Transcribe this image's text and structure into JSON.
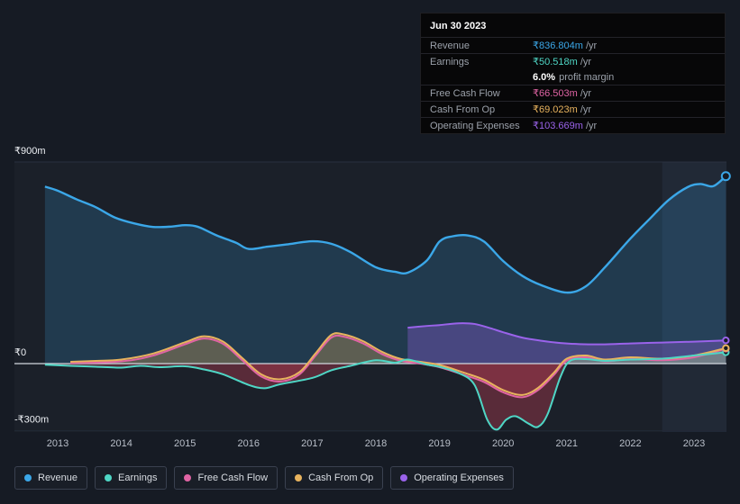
{
  "page": {
    "bg": "#161b24"
  },
  "tooltip": {
    "date": "Jun 30 2023",
    "rows": [
      {
        "label": "Revenue",
        "value": "₹836.804m",
        "suffix": "/yr",
        "color": "#3ba7e8"
      },
      {
        "label": "Earnings",
        "value": "₹50.518m",
        "suffix": "/yr",
        "color": "#4fd6c5"
      },
      {
        "label": "Free Cash Flow",
        "value": "₹66.503m",
        "suffix": "/yr",
        "color": "#e064a4"
      },
      {
        "label": "Cash From Op",
        "value": "₹69.023m",
        "suffix": "/yr",
        "color": "#e8b35e"
      },
      {
        "label": "Operating Expenses",
        "value": "₹103.669m",
        "suffix": "/yr",
        "color": "#9a63ea"
      }
    ],
    "profit_margin": {
      "value": "6.0%",
      "label": "profit margin"
    }
  },
  "legend": {
    "items": [
      {
        "label": "Revenue",
        "color": "#3ba7e8"
      },
      {
        "label": "Earnings",
        "color": "#4fd6c5"
      },
      {
        "label": "Free Cash Flow",
        "color": "#e064a4"
      },
      {
        "label": "Cash From Op",
        "color": "#e8b35e"
      },
      {
        "label": "Operating Expenses",
        "color": "#9a63ea"
      }
    ]
  },
  "chart_data": {
    "type": "area",
    "title": "Earnings and Revenue History",
    "unit": "₹ millions per year",
    "negative_fill": "#a63a4e",
    "highlight_band": {
      "from_year": 2022.5,
      "to_year": 2023.6
    },
    "x_axis": {
      "ticks": [
        2013,
        2014,
        2015,
        2016,
        2017,
        2018,
        2019,
        2020,
        2021,
        2022,
        2023
      ]
    },
    "y_axis": {
      "ticks": [
        {
          "label": "₹900m",
          "value": 900
        },
        {
          "label": "₹0",
          "value": 0
        },
        {
          "label": "-₹300m",
          "value": -300
        }
      ],
      "range": [
        -380,
        900
      ]
    },
    "series": [
      {
        "name": "Revenue",
        "color": "#3ba7e8",
        "points": [
          [
            2012.8,
            790
          ],
          [
            2013,
            772
          ],
          [
            2013.3,
            733
          ],
          [
            2013.6,
            698
          ],
          [
            2013.9,
            652
          ],
          [
            2014.2,
            626
          ],
          [
            2014.5,
            610
          ],
          [
            2014.8,
            612
          ],
          [
            2015,
            618
          ],
          [
            2015.2,
            611
          ],
          [
            2015.5,
            572
          ],
          [
            2015.8,
            540
          ],
          [
            2016,
            512
          ],
          [
            2016.3,
            522
          ],
          [
            2016.6,
            532
          ],
          [
            2017,
            546
          ],
          [
            2017.3,
            535
          ],
          [
            2017.6,
            498
          ],
          [
            2018,
            430
          ],
          [
            2018.3,
            410
          ],
          [
            2018.5,
            406
          ],
          [
            2018.8,
            460
          ],
          [
            2019,
            545
          ],
          [
            2019.2,
            568
          ],
          [
            2019.45,
            572
          ],
          [
            2019.7,
            545
          ],
          [
            2020,
            458
          ],
          [
            2020.3,
            392
          ],
          [
            2020.6,
            350
          ],
          [
            2021,
            317
          ],
          [
            2021.3,
            345
          ],
          [
            2021.6,
            430
          ],
          [
            2022,
            558
          ],
          [
            2022.3,
            645
          ],
          [
            2022.6,
            730
          ],
          [
            2022.9,
            788
          ],
          [
            2023.1,
            802
          ],
          [
            2023.3,
            792
          ],
          [
            2023.5,
            836.8
          ]
        ]
      },
      {
        "name": "Operating Expenses",
        "color": "#9a63ea",
        "points": [
          [
            2018.5,
            160
          ],
          [
            2018.8,
            168
          ],
          [
            2019,
            172
          ],
          [
            2019.3,
            180
          ],
          [
            2019.55,
            177
          ],
          [
            2019.8,
            158
          ],
          [
            2020,
            140
          ],
          [
            2020.3,
            116
          ],
          [
            2020.6,
            102
          ],
          [
            2020.9,
            92
          ],
          [
            2021.2,
            87
          ],
          [
            2021.6,
            86
          ],
          [
            2022,
            90
          ],
          [
            2022.5,
            94
          ],
          [
            2023,
            98
          ],
          [
            2023.5,
            103.7
          ]
        ]
      },
      {
        "name": "Cash From Op",
        "color": "#e8b35e",
        "points": [
          [
            2013.2,
            8
          ],
          [
            2013.6,
            12
          ],
          [
            2014,
            18
          ],
          [
            2014.5,
            45
          ],
          [
            2015,
            95
          ],
          [
            2015.3,
            122
          ],
          [
            2015.6,
            98
          ],
          [
            2015.9,
            25
          ],
          [
            2016.2,
            -48
          ],
          [
            2016.5,
            -70
          ],
          [
            2016.8,
            -38
          ],
          [
            2017.05,
            45
          ],
          [
            2017.3,
            128
          ],
          [
            2017.5,
            130
          ],
          [
            2017.8,
            100
          ],
          [
            2018.1,
            52
          ],
          [
            2018.4,
            20
          ],
          [
            2018.7,
            8
          ],
          [
            2019,
            -6
          ],
          [
            2019.4,
            -42
          ],
          [
            2019.7,
            -72
          ],
          [
            2020,
            -118
          ],
          [
            2020.3,
            -140
          ],
          [
            2020.55,
            -108
          ],
          [
            2020.8,
            -40
          ],
          [
            2021,
            22
          ],
          [
            2021.3,
            36
          ],
          [
            2021.6,
            18
          ],
          [
            2022,
            28
          ],
          [
            2022.5,
            22
          ],
          [
            2023,
            36
          ],
          [
            2023.5,
            69
          ]
        ]
      },
      {
        "name": "Free Cash Flow",
        "color": "#e064a4",
        "points": [
          [
            2013.2,
            3
          ],
          [
            2014,
            10
          ],
          [
            2014.5,
            36
          ],
          [
            2015,
            86
          ],
          [
            2015.3,
            112
          ],
          [
            2015.6,
            88
          ],
          [
            2015.9,
            15
          ],
          [
            2016.2,
            -58
          ],
          [
            2016.5,
            -80
          ],
          [
            2016.8,
            -48
          ],
          [
            2017.05,
            35
          ],
          [
            2017.3,
            116
          ],
          [
            2017.5,
            120
          ],
          [
            2017.8,
            90
          ],
          [
            2018.1,
            42
          ],
          [
            2018.4,
            12
          ],
          [
            2018.7,
            0
          ],
          [
            2019,
            -16
          ],
          [
            2019.4,
            -52
          ],
          [
            2019.7,
            -82
          ],
          [
            2020,
            -128
          ],
          [
            2020.3,
            -150
          ],
          [
            2020.55,
            -118
          ],
          [
            2020.8,
            -50
          ],
          [
            2021,
            14
          ],
          [
            2021.3,
            28
          ],
          [
            2021.6,
            10
          ],
          [
            2022,
            20
          ],
          [
            2022.5,
            15
          ],
          [
            2023,
            28
          ],
          [
            2023.5,
            66.5
          ]
        ]
      },
      {
        "name": "Earnings",
        "color": "#4fd6c5",
        "points": [
          [
            2012.8,
            -5
          ],
          [
            2013.2,
            -10
          ],
          [
            2013.6,
            -14
          ],
          [
            2014,
            -18
          ],
          [
            2014.3,
            -10
          ],
          [
            2014.6,
            -16
          ],
          [
            2015,
            -12
          ],
          [
            2015.3,
            -26
          ],
          [
            2015.6,
            -48
          ],
          [
            2016,
            -95
          ],
          [
            2016.25,
            -110
          ],
          [
            2016.5,
            -92
          ],
          [
            2017,
            -64
          ],
          [
            2017.3,
            -30
          ],
          [
            2017.6,
            -10
          ],
          [
            2018,
            15
          ],
          [
            2018.3,
            4
          ],
          [
            2018.5,
            18
          ],
          [
            2018.8,
            -4
          ],
          [
            2019,
            -14
          ],
          [
            2019.3,
            -42
          ],
          [
            2019.55,
            -95
          ],
          [
            2019.75,
            -250
          ],
          [
            2019.9,
            -295
          ],
          [
            2020.05,
            -250
          ],
          [
            2020.2,
            -235
          ],
          [
            2020.4,
            -268
          ],
          [
            2020.55,
            -282
          ],
          [
            2020.7,
            -225
          ],
          [
            2020.9,
            -60
          ],
          [
            2021.05,
            12
          ],
          [
            2021.3,
            20
          ],
          [
            2021.6,
            12
          ],
          [
            2022,
            18
          ],
          [
            2022.5,
            22
          ],
          [
            2023,
            36
          ],
          [
            2023.5,
            50.5
          ]
        ]
      }
    ]
  }
}
